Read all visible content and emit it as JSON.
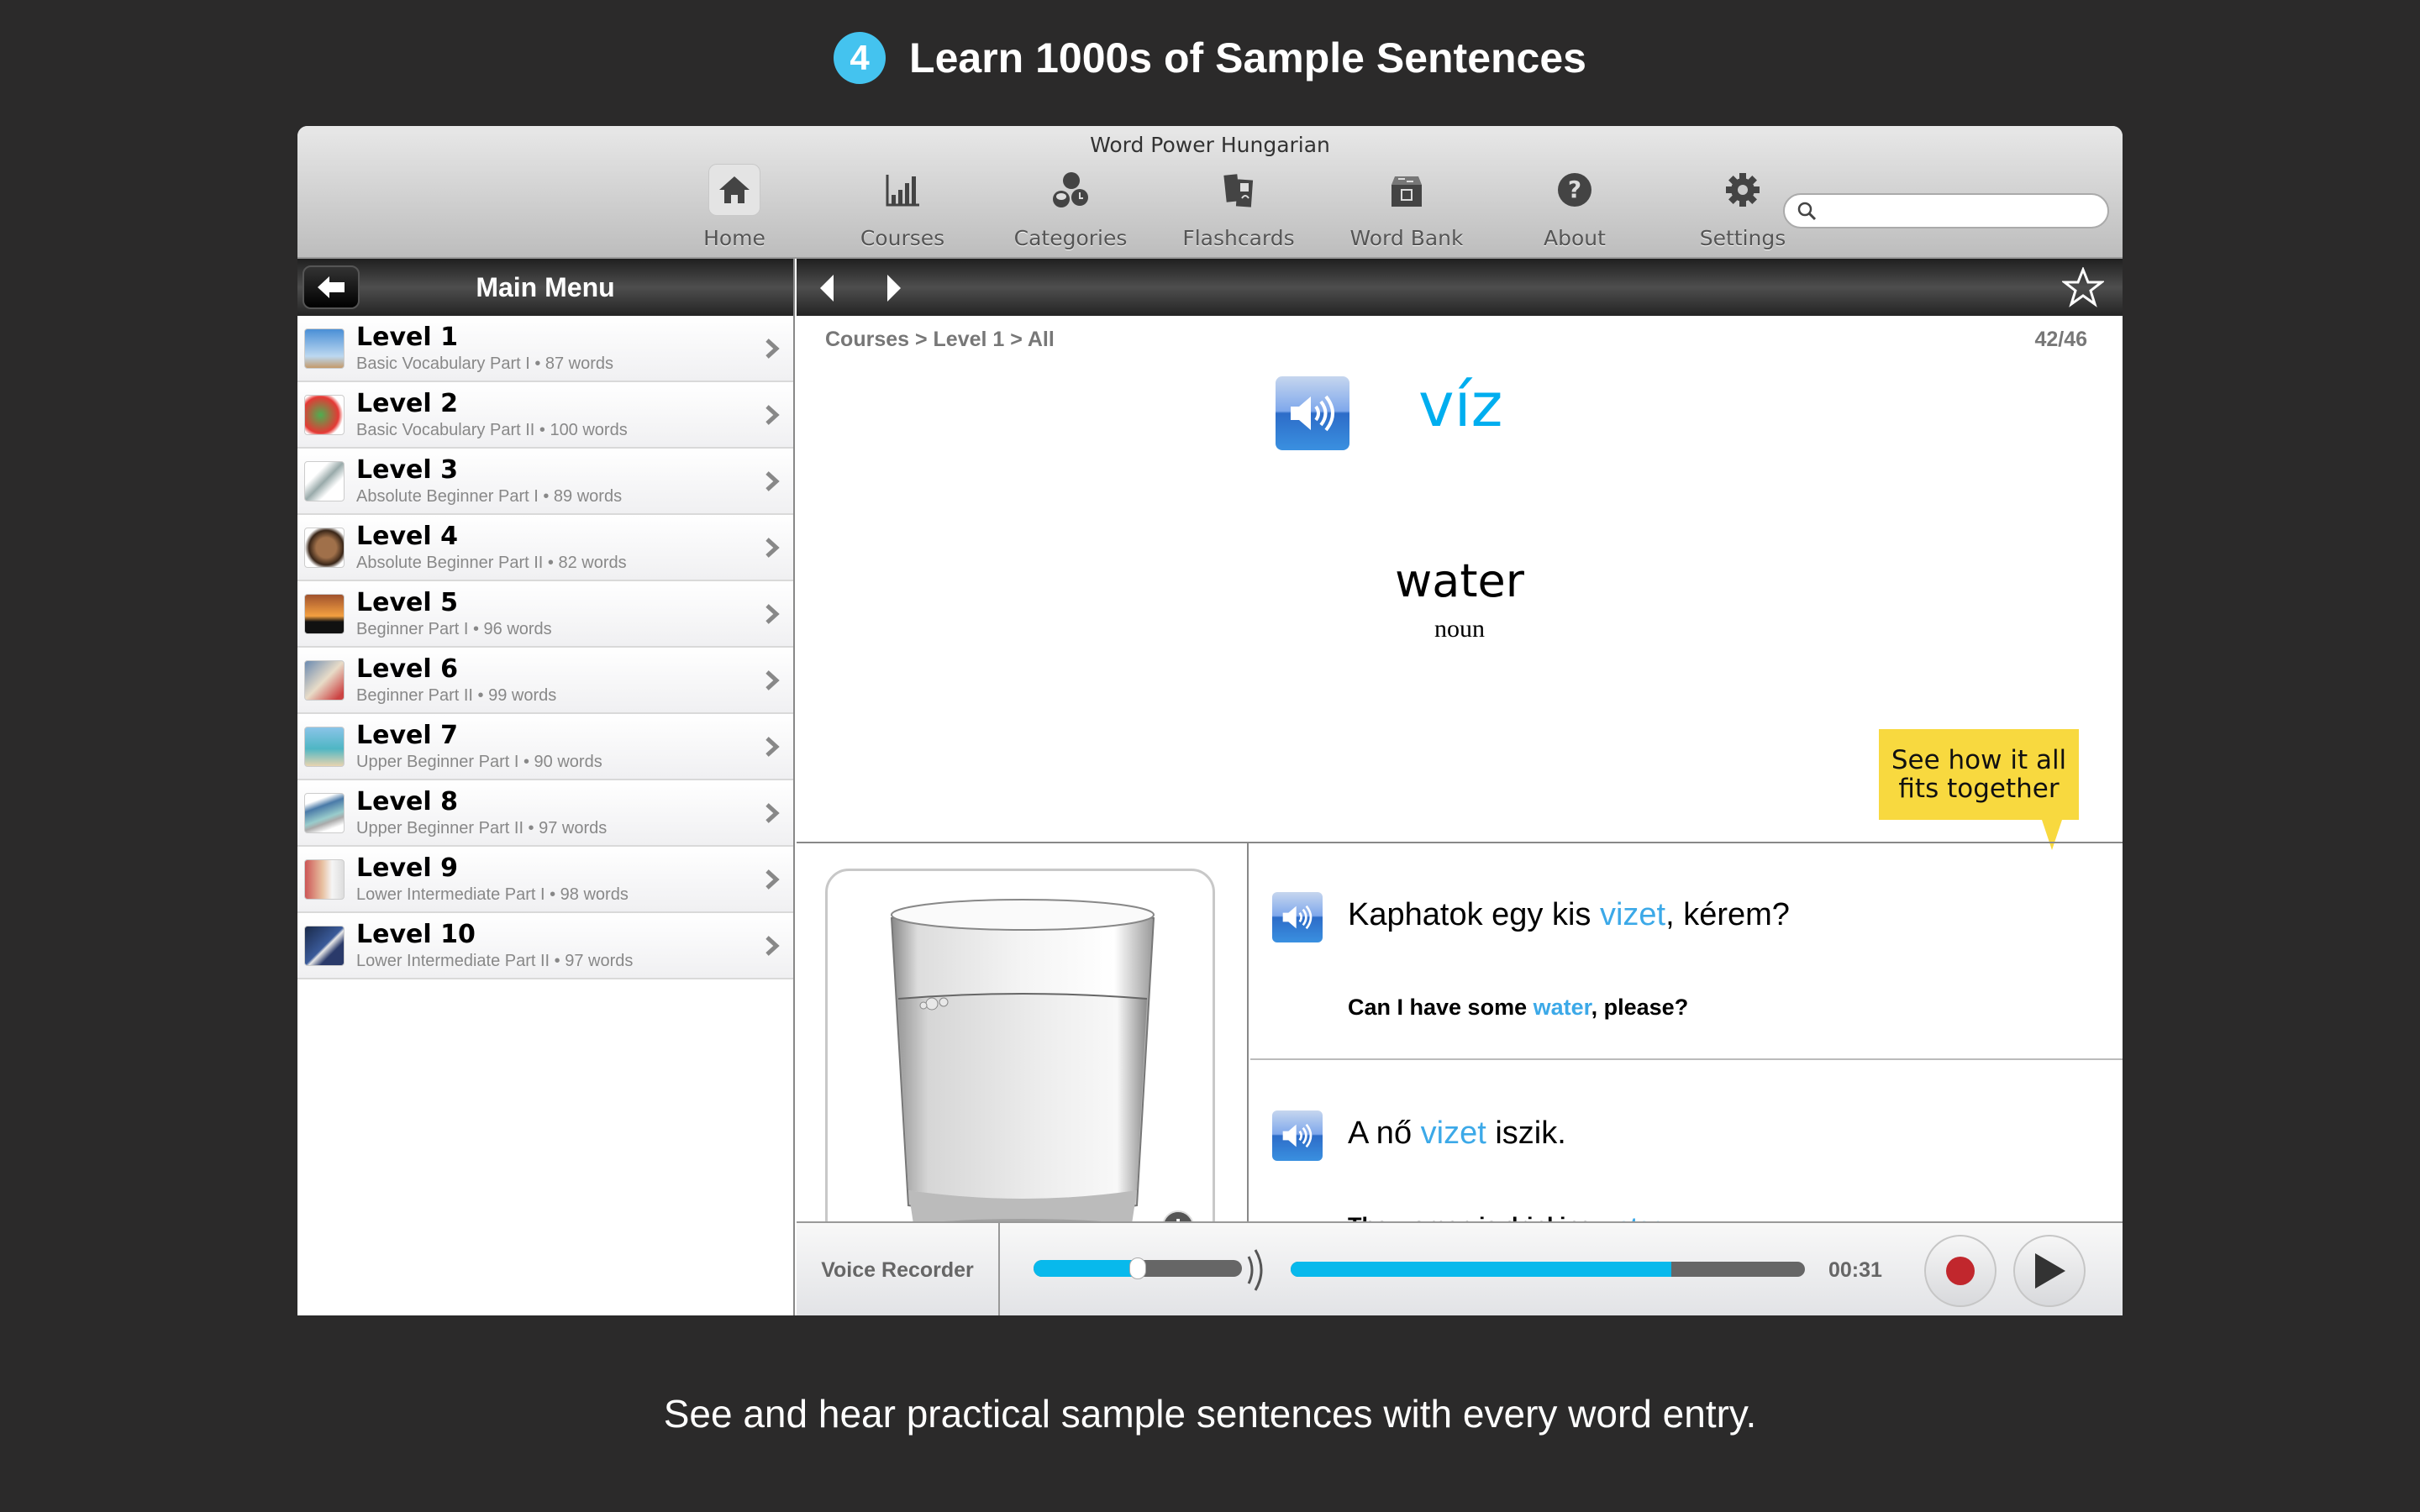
{
  "promo": {
    "step_number": "4",
    "headline": "Learn 1000s of Sample Sentences",
    "caption": "See and hear practical sample sentences with every word entry."
  },
  "window": {
    "title": "Word Power Hungarian"
  },
  "toolbar": {
    "items": [
      {
        "label": "Home",
        "icon": "home-icon",
        "active": true
      },
      {
        "label": "Courses",
        "icon": "bar-chart-icon"
      },
      {
        "label": "Categories",
        "icon": "categories-icon"
      },
      {
        "label": "Flashcards",
        "icon": "flashcards-icon"
      },
      {
        "label": "Word Bank",
        "icon": "word-bank-icon"
      },
      {
        "label": "About",
        "icon": "question-icon"
      },
      {
        "label": "Settings",
        "icon": "gear-icon"
      }
    ],
    "search_placeholder": "",
    "search_value": ""
  },
  "sidebar": {
    "title": "Main Menu",
    "levels": [
      {
        "name": "Level 1",
        "subtitle": "Basic Vocabulary Part I • 87 words"
      },
      {
        "name": "Level 2",
        "subtitle": "Basic Vocabulary Part II • 100 words"
      },
      {
        "name": "Level 3",
        "subtitle": "Absolute Beginner Part I • 89 words"
      },
      {
        "name": "Level 4",
        "subtitle": "Absolute Beginner Part II • 82 words"
      },
      {
        "name": "Level 5",
        "subtitle": "Beginner Part I • 96 words"
      },
      {
        "name": "Level 6",
        "subtitle": "Beginner Part II • 99 words"
      },
      {
        "name": "Level 7",
        "subtitle": "Upper Beginner Part I • 90 words"
      },
      {
        "name": "Level 8",
        "subtitle": "Upper Beginner Part II • 97 words"
      },
      {
        "name": "Level 9",
        "subtitle": "Lower Intermediate Part I • 98 words"
      },
      {
        "name": "Level 10",
        "subtitle": "Lower Intermediate Part II • 97 words"
      }
    ]
  },
  "card": {
    "breadcrumb": "Courses > Level 1 > All",
    "counter": "42/46",
    "word": "víz",
    "translation": "water",
    "part_of_speech": "noun",
    "tooltip": "See how it all fits together",
    "image_description": "glass of water",
    "sentences": [
      {
        "hu_before": "Kaphatok egy kis ",
        "hu_highlight": "vizet",
        "hu_after": ", kérem?",
        "en_before": "Can I have some ",
        "en_highlight": "water",
        "en_after": ", please?"
      },
      {
        "hu_before": "A nő ",
        "hu_highlight": "vizet",
        "hu_after": " iszik.",
        "en_before": "The woman is drinking ",
        "en_highlight": "water",
        "en_after": "."
      }
    ]
  },
  "recorder": {
    "label": "Voice Recorder",
    "volume_fraction": 0.5,
    "progress_fraction": 0.74,
    "time": "00:31"
  },
  "colors": {
    "accent": "#00aeef",
    "highlight": "#3ca9e8",
    "tooltip": "#f8d93f",
    "record": "#c1272d",
    "badge": "#44c3ef"
  }
}
